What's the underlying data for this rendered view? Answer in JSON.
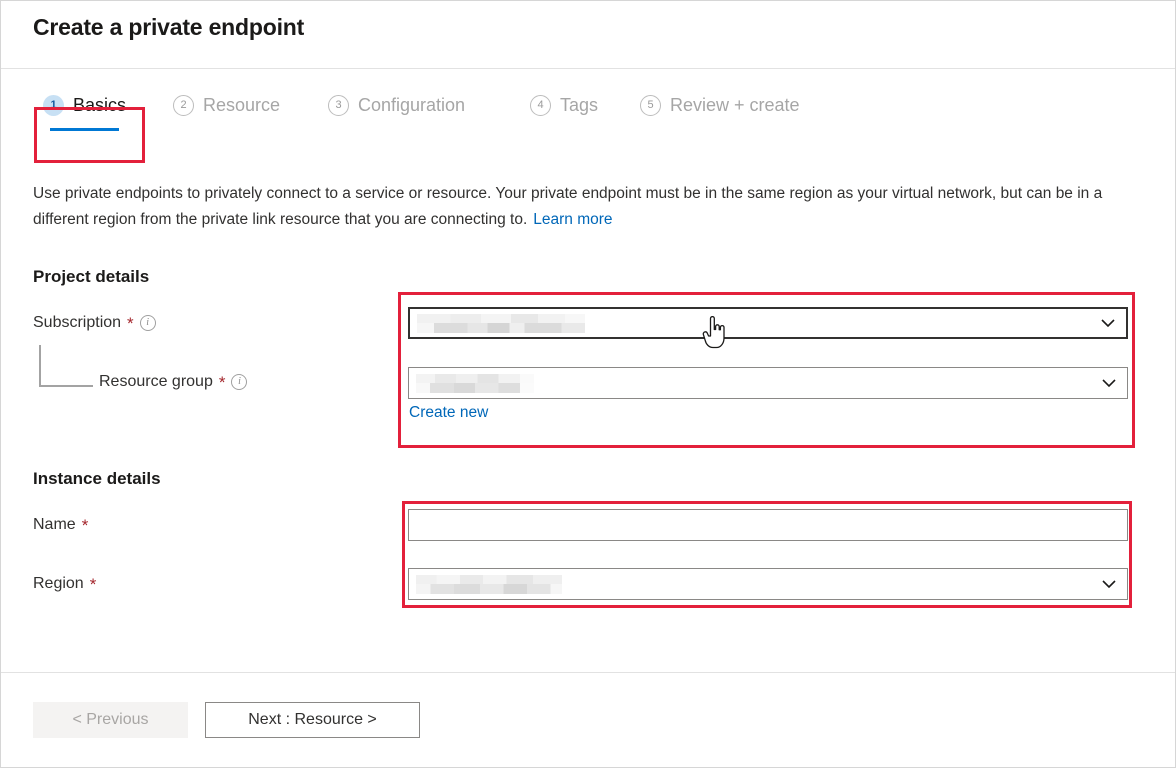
{
  "header": {
    "title": "Create a private endpoint"
  },
  "tabs": [
    {
      "num": "1",
      "label": "Basics",
      "active": true
    },
    {
      "num": "2",
      "label": "Resource",
      "active": false
    },
    {
      "num": "3",
      "label": "Configuration",
      "active": false
    },
    {
      "num": "4",
      "label": "Tags",
      "active": false
    },
    {
      "num": "5",
      "label": "Review + create",
      "active": false
    }
  ],
  "intro": {
    "text": "Use private endpoints to privately connect to a service or resource. Your private endpoint must be in the same region as your virtual network, but can be in a different region from the private link resource that you are connecting to.",
    "link_label": "Learn more"
  },
  "sections": {
    "project_details": {
      "title": "Project details",
      "subscription": {
        "label": "Subscription",
        "required": "*",
        "info": "i",
        "value": "",
        "chevron": "chevron-down-icon",
        "redacted": true
      },
      "resource_group": {
        "label": "Resource group",
        "required": "*",
        "info": "i",
        "value": "",
        "chevron": "chevron-down-icon",
        "redacted": true,
        "create_new_label": "Create new"
      }
    },
    "instance_details": {
      "title": "Instance details",
      "name": {
        "label": "Name",
        "required": "*",
        "value": "",
        "placeholder": ""
      },
      "region": {
        "label": "Region",
        "required": "*",
        "value": "",
        "chevron": "chevron-down-icon",
        "redacted": true
      }
    }
  },
  "footer": {
    "previous_label": "< Previous",
    "previous_disabled": true,
    "next_label": "Next : Resource >"
  },
  "annotations": {
    "color": "#e3203b",
    "boxes": [
      "basics-tab",
      "project-details-fields",
      "instance-details-fields",
      "next-button"
    ]
  },
  "cursor": {
    "type": "pointer-hand-cursor"
  }
}
